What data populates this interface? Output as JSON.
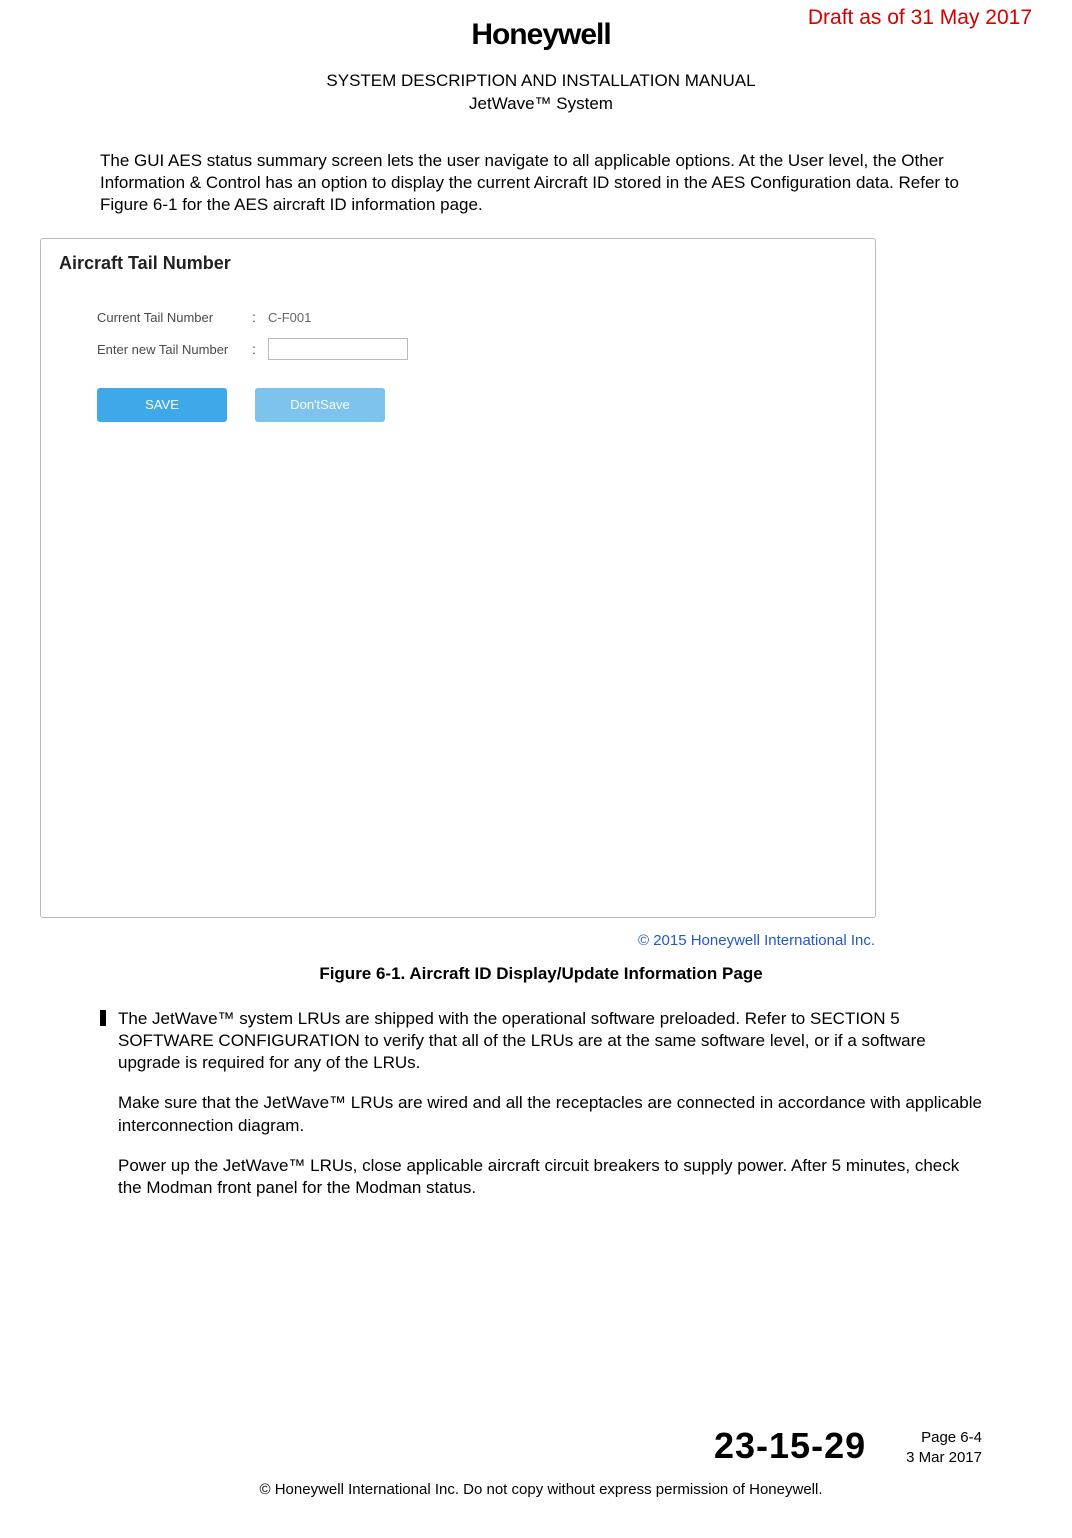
{
  "draft_notice": "Draft as of 31 May 2017",
  "logo_text": "Honeywell",
  "doc_title_line1": "SYSTEM DESCRIPTION AND INSTALLATION MANUAL",
  "doc_title_line2": "JetWave™ System",
  "para1": "The GUI AES status summary screen lets the user navigate to all applicable options. At the User level, the Other Information & Control has an option to display the current Aircraft ID stored in the AES Configuration data. Refer to Figure 6-1 for the AES aircraft ID information page.",
  "screenshot": {
    "panel_title": "Aircraft Tail Number",
    "current_label": "Current Tail Number",
    "current_value": "C-F001",
    "enter_label": "Enter new Tail Number",
    "save_btn": "SAVE",
    "dont_save_btn": "Don'tSave",
    "copyright": "© 2015 Honeywell International Inc."
  },
  "figure_caption": "Figure 6-1.  Aircraft ID Display/Update Information Page",
  "para2": "The JetWave™ system LRUs are shipped with the operational software preloaded. Refer to SECTION 5 SOFTWARE CONFIGURATION to verify that all of the LRUs are at the same software level, or if a software upgrade is required for any of the LRUs.",
  "para3": "Make sure that the JetWave™ LRUs are wired and all the receptacles are connected in accordance with applicable interconnection diagram.",
  "para4": "Power up the JetWave™ LRUs, close applicable aircraft circuit breakers to supply power. After 5 minutes, check the Modman front panel for the Modman status.",
  "footer": {
    "doc_number": "23-15-29",
    "page": "Page 6-4",
    "date": "3 Mar 2017",
    "copyright": "© Honeywell International Inc. Do not copy without express permission of Honeywell."
  }
}
